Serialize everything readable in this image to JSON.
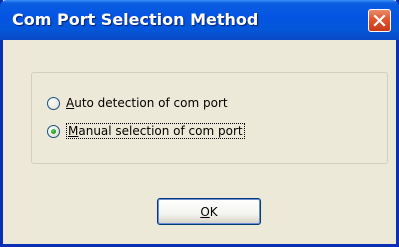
{
  "window": {
    "title": "Com Port Selection Method",
    "close_icon": "close-icon"
  },
  "options": [
    {
      "label_accel": "A",
      "label_rest": "uto detection of com port",
      "selected": false
    },
    {
      "label_accel": "M",
      "label_rest": "anual selection of com port",
      "selected": true
    }
  ],
  "ok_button": {
    "accel": "O",
    "rest": "K"
  },
  "colors": {
    "titlebar": "#0554e3",
    "close_button": "#e2542e",
    "dialog_bg": "#ece9d8",
    "radio_dot": "#21a121"
  }
}
